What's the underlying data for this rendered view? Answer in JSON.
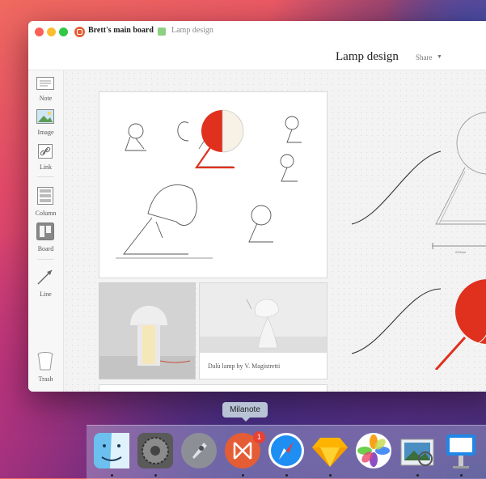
{
  "window": {
    "breadcrumb_board": "Brett's main board",
    "breadcrumb_page": "Lamp design"
  },
  "header": {
    "title": "Lamp design",
    "share_label": "Share"
  },
  "sidebar": {
    "tools": [
      {
        "label": "Note",
        "icon": "note-icon"
      },
      {
        "label": "Image",
        "icon": "image-icon"
      },
      {
        "label": "Link",
        "icon": "link-icon"
      },
      {
        "label": "Column",
        "icon": "column-icon"
      },
      {
        "label": "Board",
        "icon": "board-icon"
      },
      {
        "label": "Line",
        "icon": "line-icon"
      },
      {
        "label": "Trash",
        "icon": "trash-icon"
      }
    ]
  },
  "cards": {
    "photo_caption": "Dalù lamp by V. Magistretti"
  },
  "dock": {
    "tooltip": "Milanote",
    "badge_count": "1",
    "apps": [
      "Finder",
      "System Preferences",
      "Launchpad",
      "Milanote",
      "Safari",
      "Sketch",
      "Photos",
      "Preview",
      "Keynote"
    ]
  },
  "colors": {
    "accent_red": "#e0301e",
    "board_icon": "#e55d35",
    "page_icon": "#8fcf82"
  }
}
